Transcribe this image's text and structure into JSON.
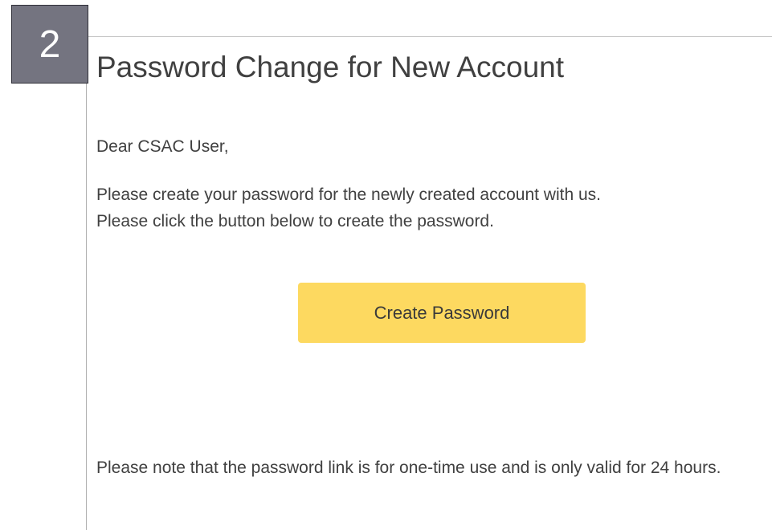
{
  "step": {
    "number": "2"
  },
  "email": {
    "title": "Password Change for New Account",
    "greeting": "Dear CSAC User,",
    "instructions": [
      "Please create your password for the newly created account with us.",
      "Please click the button below to create the password."
    ],
    "button_label": "Create Password",
    "note": "Please note that the password link is for one-time use and is only valid for 24 hours."
  },
  "colors": {
    "button_bg": "#fdd960",
    "badge_bg": "#747480",
    "text": "#404040"
  }
}
